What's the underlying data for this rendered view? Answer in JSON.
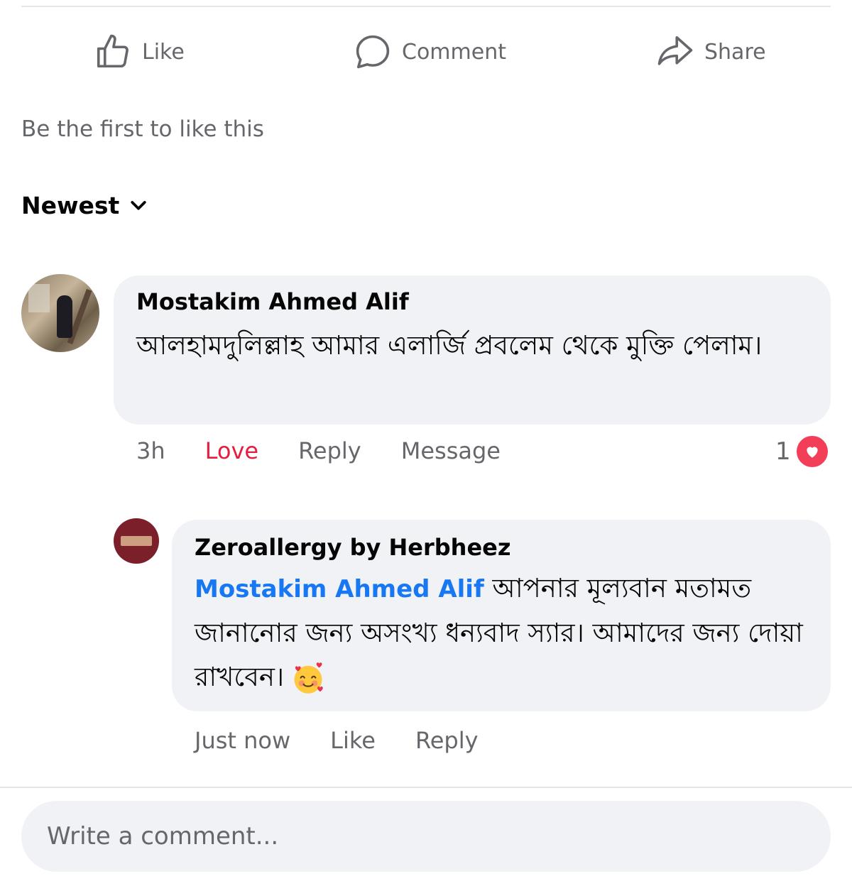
{
  "actions": {
    "like_label": "Like",
    "comment_label": "Comment",
    "share_label": "Share"
  },
  "reactions_summary": "Be the first to like this",
  "sort": {
    "label": "Newest",
    "icon": "chevron-down-icon"
  },
  "comments": [
    {
      "author": "Mostakim Ahmed Alif",
      "text": "আলহামদুলিল্লাহ আমার এলার্জি প্রবলেম থেকে মুক্তি পেলাম।",
      "time": "3h",
      "reaction_label": "Love",
      "reply_label": "Reply",
      "message_label": "Message",
      "reaction_count": "1",
      "reaction_icon": "heart-icon"
    }
  ],
  "reply": {
    "author": "Zeroallergy by Herbheez",
    "mention": "Mostakim Ahmed Alif",
    "text": " আপনার মূল্যবান মতামত জানানোর জন্য অসংখ্য ধন্যবাদ স্যার। আমাদের জন্য দোয়া রাখবেন।",
    "emoji": "smiling-face-with-hearts",
    "time": "Just now",
    "like_label": "Like",
    "reply_label": "Reply"
  },
  "composer": {
    "placeholder": "Write a comment..."
  },
  "colors": {
    "love": "#e41e3f",
    "mention": "#1877f2",
    "bubble": "#f0f2f5",
    "secondary_text": "#65676b"
  }
}
